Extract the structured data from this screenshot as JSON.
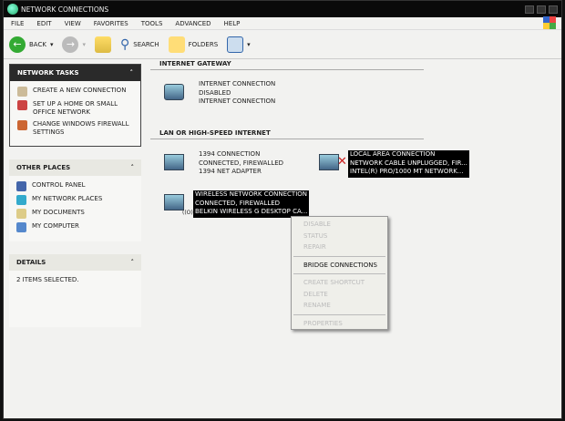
{
  "window": {
    "title": "Network Connections"
  },
  "menu": [
    "File",
    "Edit",
    "View",
    "Favorites",
    "Tools",
    "Advanced",
    "Help"
  ],
  "toolbar": {
    "back": "Back",
    "search": "Search",
    "folders": "Folders"
  },
  "network_tasks": {
    "title": "Network Tasks",
    "items": [
      "Create a new connection",
      "Set up a home or small office network",
      "Change Windows Firewall settings"
    ]
  },
  "other_places": {
    "title": "Other Places",
    "items": [
      "Control Panel",
      "My Network Places",
      "My Documents",
      "My Computer"
    ]
  },
  "details": {
    "title": "Details",
    "text": "2 items selected."
  },
  "sections": {
    "gateway": "Internet Gateway",
    "lan": "LAN or High-Speed Internet"
  },
  "gateway": {
    "name": "Internet Connection",
    "status": "Disabled",
    "device": "Internet Connection"
  },
  "connections": [
    {
      "name": "1394 Connection",
      "status": "Connected, Firewalled",
      "device": "1394 Net Adapter"
    },
    {
      "name": "Local Area Connection",
      "status": "Network cable unplugged, Fir...",
      "device": "Intel(R) PRO/1000 MT Network..."
    },
    {
      "name": "Wireless Network Connection",
      "status": "Connected, Firewalled",
      "device": "Belkin Wireless G Desktop Ca..."
    }
  ],
  "context_menu": [
    "Disable",
    "Status",
    "Repair",
    "Bridge Connections",
    "Create Shortcut",
    "Delete",
    "Rename",
    "Properties"
  ]
}
